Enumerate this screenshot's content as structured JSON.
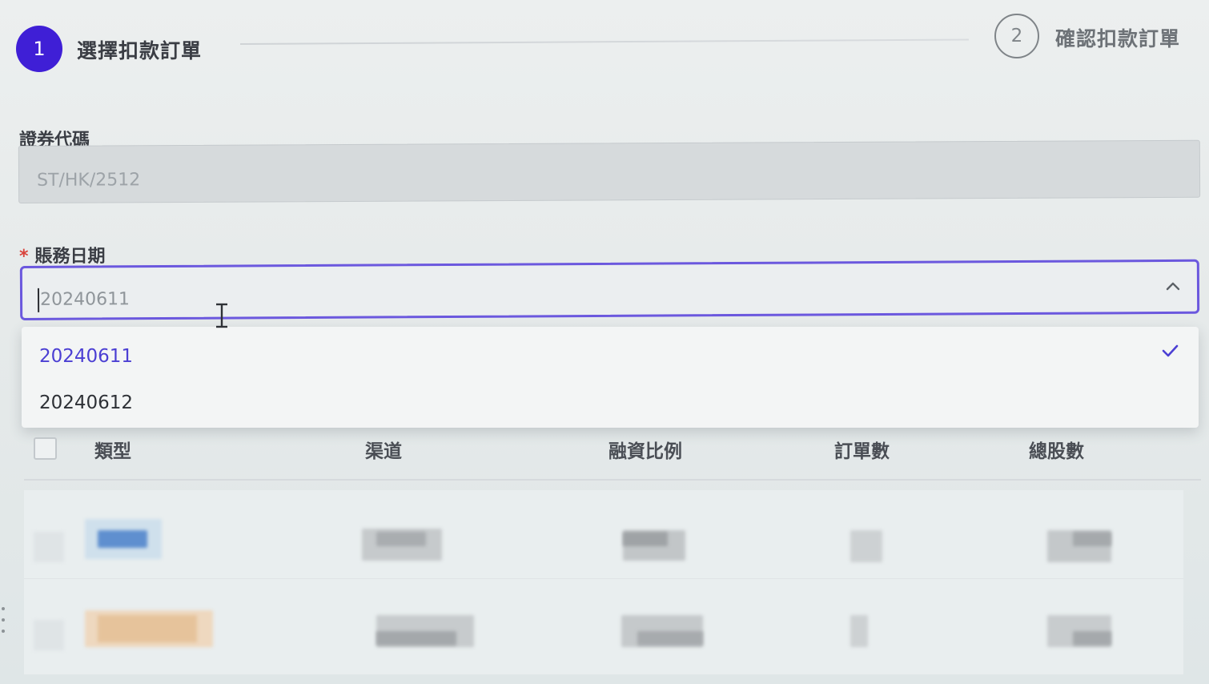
{
  "stepper": {
    "step1": {
      "number": "1",
      "label": "選擇扣款訂單",
      "state": "active"
    },
    "step2": {
      "number": "2",
      "label": "確認扣款訂單",
      "state": "inactive"
    },
    "accent_color": "#3f1fd6"
  },
  "form": {
    "security_code": {
      "label": "證券代碼",
      "value": "ST/HK/2512",
      "disabled": true
    },
    "account_date": {
      "label": "賬務日期",
      "required_mark": "*",
      "value": "20240611",
      "expanded": true,
      "options": [
        {
          "label": "20240611",
          "selected": true
        },
        {
          "label": "20240612",
          "selected": false
        }
      ],
      "expand_icon": "chevron-up-icon",
      "selected_icon": "check-icon",
      "border_color": "#6b58de"
    }
  },
  "table": {
    "columns": [
      "類型",
      "渠道",
      "融資比例",
      "訂單數",
      "總股數"
    ],
    "select_all_checked": false
  },
  "icons": {
    "text_cursor": "ibeam-cursor-icon"
  },
  "colors": {
    "selected_option_text": "#4b3fd3",
    "required_star": "#d9443c"
  }
}
